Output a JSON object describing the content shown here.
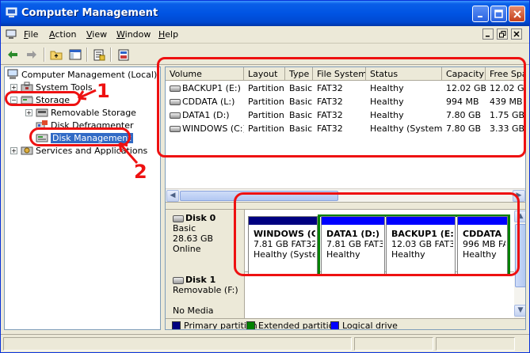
{
  "window": {
    "title": "Computer Management"
  },
  "menubar": {
    "items": [
      {
        "label": "File",
        "accel": "F",
        "rest": "ile"
      },
      {
        "label": "Action",
        "accel": "A",
        "rest": "ction"
      },
      {
        "label": "View",
        "accel": "V",
        "rest": "iew"
      },
      {
        "label": "Window",
        "accel": "W",
        "rest": "indow"
      },
      {
        "label": "Help",
        "accel": "H",
        "rest": "elp"
      }
    ]
  },
  "tree": {
    "root": "Computer Management (Local)",
    "system_tools": "System Tools",
    "storage": "Storage",
    "removable_storage": "Removable Storage",
    "disk_defragmenter": "Disk Defragmenter",
    "disk_management": "Disk Management",
    "services": "Services and Applications"
  },
  "volumes": {
    "columns": [
      "Volume",
      "Layout",
      "Type",
      "File System",
      "Status",
      "Capacity",
      "Free Spa"
    ],
    "rows": [
      {
        "volume": "BACKUP1 (E:)",
        "layout": "Partition",
        "type": "Basic",
        "fs": "FAT32",
        "status": "Healthy",
        "capacity": "12.02 GB",
        "free": "12.02 GB"
      },
      {
        "volume": "CDDATA (L:)",
        "layout": "Partition",
        "type": "Basic",
        "fs": "FAT32",
        "status": "Healthy",
        "capacity": "994 MB",
        "free": "439 MB"
      },
      {
        "volume": "DATA1 (D:)",
        "layout": "Partition",
        "type": "Basic",
        "fs": "FAT32",
        "status": "Healthy",
        "capacity": "7.80 GB",
        "free": "1.75 GB"
      },
      {
        "volume": "WINDOWS (C:)",
        "layout": "Partition",
        "type": "Basic",
        "fs": "FAT32",
        "status": "Healthy (System)",
        "capacity": "7.80 GB",
        "free": "3.33 GB"
      }
    ]
  },
  "disk0": {
    "name": "Disk 0",
    "type": "Basic",
    "size": "28.63 GB",
    "state": "Online",
    "partitions": [
      {
        "name": "WINDOWS (C",
        "size": "7.81 GB FAT32",
        "status": "Healthy (Syste",
        "color": "#000080"
      },
      {
        "name": "DATA1 (D:)",
        "size": "7.81 GB FAT3:",
        "status": "Healthy",
        "color": "#0000ff"
      },
      {
        "name": "BACKUP1 (E:)",
        "size": "12.03 GB FAT32",
        "status": "Healthy",
        "color": "#0000ff"
      },
      {
        "name": "CDDATA",
        "size": "996 MB FA",
        "status": "Healthy",
        "color": "#0000ff"
      }
    ]
  },
  "disk1": {
    "name": "Disk 1",
    "type": "Removable (F:)",
    "media": "No Media"
  },
  "legend": {
    "primary": {
      "label": "Primary partition",
      "color": "#000080"
    },
    "extended": {
      "label": "Extended partition",
      "color": "#008000"
    },
    "logical": {
      "label": "Logical drive",
      "color": "#0000ff"
    }
  },
  "annotations": {
    "one": "1",
    "two": "2",
    "color": "#ee1111"
  }
}
